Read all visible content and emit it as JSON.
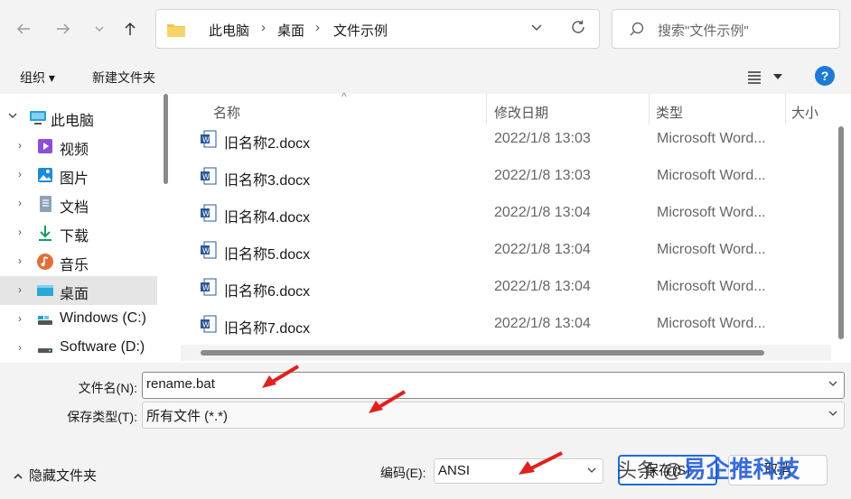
{
  "address": {
    "crumbs": [
      "此电脑",
      "桌面",
      "文件示例"
    ],
    "search_placeholder": "搜索\"文件示例\""
  },
  "toolbar": {
    "organize": "组织 ▾",
    "new_folder": "新建文件夹"
  },
  "sidebar": {
    "items": [
      {
        "label": "此电脑",
        "icon": "computer-icon"
      },
      {
        "label": "视频",
        "icon": "video-icon"
      },
      {
        "label": "图片",
        "icon": "pictures-icon"
      },
      {
        "label": "文档",
        "icon": "document-icon"
      },
      {
        "label": "下载",
        "icon": "download-icon"
      },
      {
        "label": "音乐",
        "icon": "music-icon"
      },
      {
        "label": "桌面",
        "icon": "desktop-icon"
      },
      {
        "label": "Windows (C:)",
        "icon": "drive-icon"
      },
      {
        "label": "Software (D:)",
        "icon": "drive-icon"
      }
    ]
  },
  "columns": {
    "name": "名称",
    "date": "修改日期",
    "type": "类型",
    "size": "大小"
  },
  "files": [
    {
      "name": "旧名称2.docx",
      "date": "2022/1/8 13:03",
      "type": "Microsoft Word..."
    },
    {
      "name": "旧名称3.docx",
      "date": "2022/1/8 13:03",
      "type": "Microsoft Word..."
    },
    {
      "name": "旧名称4.docx",
      "date": "2022/1/8 13:04",
      "type": "Microsoft Word..."
    },
    {
      "name": "旧名称5.docx",
      "date": "2022/1/8 13:04",
      "type": "Microsoft Word..."
    },
    {
      "name": "旧名称6.docx",
      "date": "2022/1/8 13:04",
      "type": "Microsoft Word..."
    },
    {
      "name": "旧名称7.docx",
      "date": "2022/1/8 13:04",
      "type": "Microsoft Word..."
    }
  ],
  "form": {
    "filename_label": "文件名(N):",
    "filename_value": "rename.bat",
    "filetype_label": "保存类型(T):",
    "filetype_value": "所有文件 (*.*)",
    "encoding_label": "编码(E):",
    "encoding_value": "ANSI"
  },
  "bottom": {
    "hide_folders": "隐藏文件夹",
    "save": "保存(S)",
    "cancel": "取消"
  },
  "watermark": {
    "prefix": "头条 @",
    "text": "易企推科技"
  },
  "colors": {
    "accent": "#1f7ad6",
    "arrow": "#e02020"
  }
}
